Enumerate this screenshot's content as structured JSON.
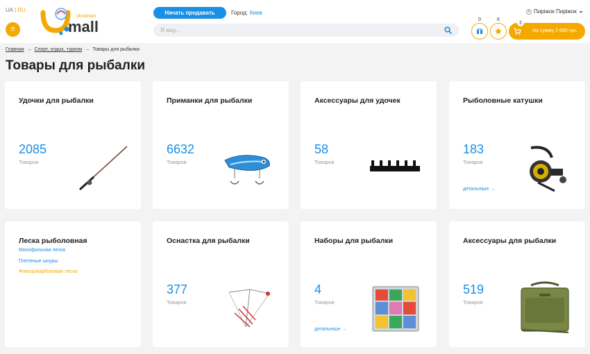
{
  "header": {
    "lang_ua": "UA",
    "lang_sep": "|",
    "lang_ru": "RU",
    "logo_small": "ukrainian",
    "logo_main": "mall",
    "sell_button": "Начать продавать",
    "city_label": "Город:",
    "city_value": "Киев",
    "search_placeholder": "Я ищу...",
    "user_name": "Пиріжок Пиріжок",
    "compare_count": "0",
    "favorites_count": "6",
    "cart_count": "2",
    "cart_text": "На сумму 2 660 грн."
  },
  "breadcrumb": {
    "items": [
      "Главная",
      "Спорт, отдых, туризм",
      "Товары для рыбалки"
    ],
    "arrow": "→"
  },
  "page_title": "Товары для рыбалки",
  "cards": [
    {
      "title": "Удочки для рыбалки",
      "count": "2085",
      "unit": "Товаров"
    },
    {
      "title": "Приманки для рыбалки",
      "count": "6632",
      "unit": "Товаров"
    },
    {
      "title": "Аксессуары для удочек",
      "count": "58",
      "unit": "Товаров"
    },
    {
      "title": "Рыболовные катушки",
      "count": "183",
      "unit": "Товаров",
      "more": "детальніше →"
    },
    {
      "title": "Леска рыболовная",
      "subitems": [
        "Монофильная леска",
        "Плетеные шнуры",
        "Флюорокарбоновая леска"
      ]
    },
    {
      "title": "Оснастка для рыбалки",
      "count": "377",
      "unit": "Товаров"
    },
    {
      "title": "Наборы для рыбалки",
      "count": "4",
      "unit": "Товаров",
      "more": "детальніше →"
    },
    {
      "title": "Аксессуары для рыбалки",
      "count": "519",
      "unit": "Товаров"
    }
  ],
  "colors": {
    "accent_orange": "#f5a800",
    "accent_blue": "#1a8fe3"
  }
}
